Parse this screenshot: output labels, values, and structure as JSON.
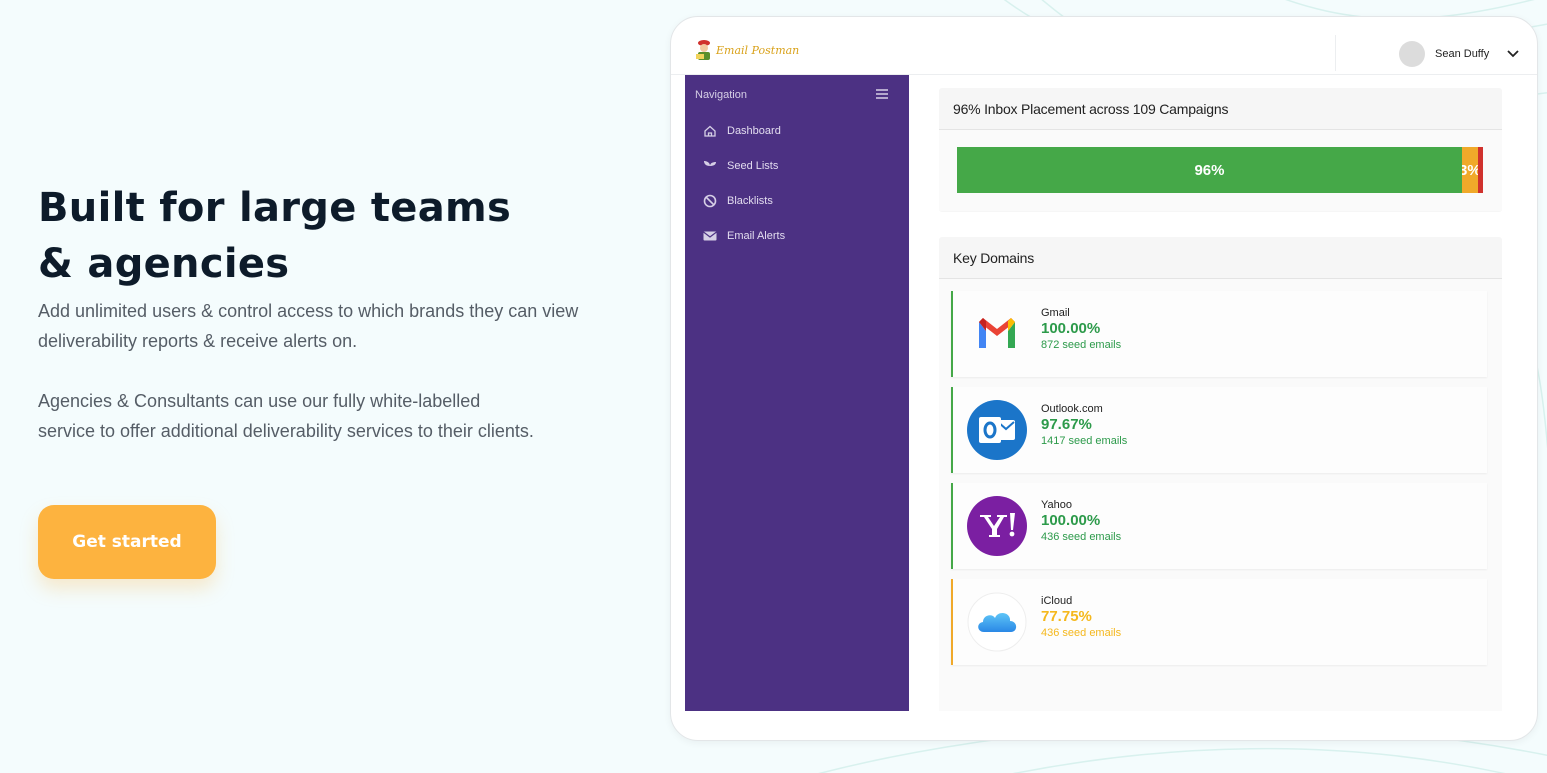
{
  "hero": {
    "title_line1": "Built for large teams",
    "title_line2": "& agencies",
    "para1": "Add unlimited users & control access to which brands they can view deliverability reports & receive alerts on.",
    "para2": "Agencies & Consultants can use our fully white-labelled service to offer additional deliverability services to their clients.",
    "cta_label": "Get started"
  },
  "app": {
    "logo_text": "Email Postman",
    "user_name": "Sean Duffy",
    "nav": {
      "heading": "Navigation",
      "items": [
        {
          "label": "Dashboard",
          "icon": "home-icon"
        },
        {
          "label": "Seed Lists",
          "icon": "seedling-icon"
        },
        {
          "label": "Blacklists",
          "icon": "ban-icon"
        },
        {
          "label": "Email Alerts",
          "icon": "envelope-icon"
        }
      ]
    },
    "placement": {
      "title": "96% Inbox Placement across 109 Campaigns",
      "segments": [
        {
          "label": "96%",
          "value": 96,
          "color": "#45a848"
        },
        {
          "label": "3%",
          "value": 3,
          "color": "#f0a92a"
        },
        {
          "label": "",
          "value": 1,
          "color": "#d0312d"
        }
      ]
    },
    "domains": {
      "title": "Key Domains",
      "items": [
        {
          "name": "Gmail",
          "percent": "100.00%",
          "seeds": "872 seed emails",
          "icon": "gmail-icon",
          "status": "good"
        },
        {
          "name": "Outlook.com",
          "percent": "97.67%",
          "seeds": "1417 seed emails",
          "icon": "outlook-icon",
          "status": "good"
        },
        {
          "name": "Yahoo",
          "percent": "100.00%",
          "seeds": "436 seed emails",
          "icon": "yahoo-icon",
          "status": "good"
        },
        {
          "name": "iCloud",
          "percent": "77.75%",
          "seeds": "436 seed emails",
          "icon": "icloud-icon",
          "status": "warn"
        }
      ]
    }
  },
  "colors": {
    "accent": "#fdb33f",
    "sidebar": "#4c3183",
    "good": "#2c9a4a",
    "warn": "#f5b81d"
  }
}
